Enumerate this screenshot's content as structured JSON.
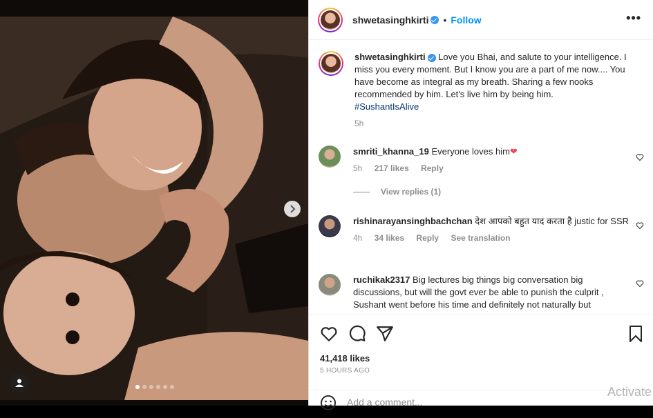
{
  "header": {
    "username": "shwetasinghkirti",
    "follow_label": "Follow",
    "separator": "•",
    "more_label": "•••"
  },
  "caption": {
    "username": "shwetasinghkirti",
    "text": "Love you Bhai, and salute to your intelligence. I miss you every moment. But I know you are a part of me now.... You have become as integral as my breath. Sharing a few nooks recommended by him. Let's live him by being him.",
    "hashtag": "#SushantIsAlive",
    "time": "5h"
  },
  "comments": [
    {
      "username": "smriti_khanna_19",
      "text": "Everyone loves him",
      "emoji": "❤",
      "time": "5h",
      "likes": "217 likes",
      "reply_label": "Reply",
      "view_replies": "View replies (1)"
    },
    {
      "username": "rishinarayansinghbachchan",
      "text": "देश आपको बहुत याद करता है justic for SSR",
      "time": "4h",
      "likes": "34 likes",
      "reply_label": "Reply",
      "translate_label": "See translation"
    },
    {
      "username": "ruchikak2317",
      "text": "Big lectures big things big conversation big discussions, but will the govt ever be able to punish the culprit , Sushant went before his time and definitely not naturally but"
    }
  ],
  "actions": {
    "like_icon": "heart-icon",
    "comment_icon": "comment-icon",
    "share_icon": "share-icon",
    "save_icon": "bookmark-icon",
    "likes_count": "41,418 likes",
    "posted_ago": "5 HOURS AGO"
  },
  "add_comment": {
    "placeholder": "Add a comment...",
    "emoji_icon": "smiley-icon"
  },
  "carousel": {
    "total_slides": 6,
    "current_slide": 1
  },
  "watermark": "Activate",
  "colors": {
    "accent": "#0095f6",
    "verified": "#3897f0",
    "heart_red": "#ed4956",
    "text": "#262626",
    "muted": "#8e8e8e"
  }
}
